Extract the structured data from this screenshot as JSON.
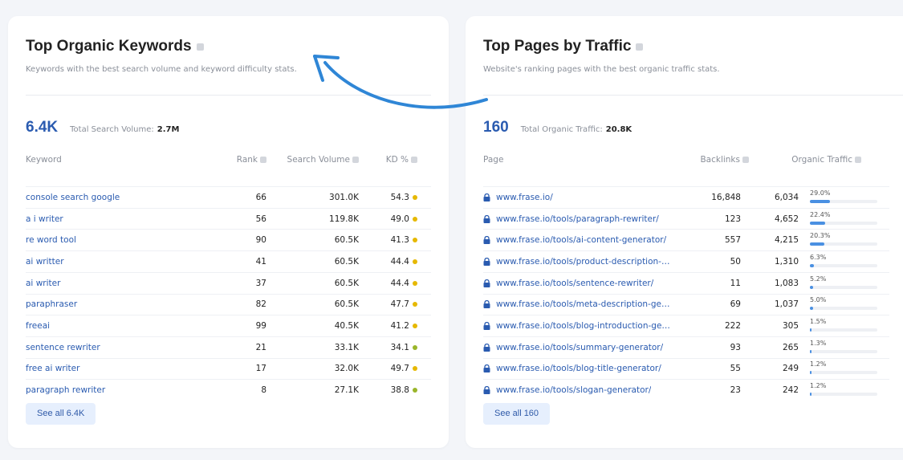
{
  "left": {
    "title": "Top Organic Keywords",
    "subtitle": "Keywords with the best search volume and keyword difficulty stats.",
    "big_number": "6.4K",
    "summary_label": "Total Search Volume:",
    "summary_value": "2.7M",
    "columns": {
      "keyword": "Keyword",
      "rank": "Rank",
      "volume": "Search Volume",
      "kd": "KD %"
    },
    "rows": [
      {
        "keyword": "console search google",
        "rank": "66",
        "volume": "301.0K",
        "kd": "54.3",
        "kd_color": "#e6b800"
      },
      {
        "keyword": "a i writer",
        "rank": "56",
        "volume": "119.8K",
        "kd": "49.0",
        "kd_color": "#e6b800"
      },
      {
        "keyword": "re word tool",
        "rank": "90",
        "volume": "60.5K",
        "kd": "41.3",
        "kd_color": "#e6b800"
      },
      {
        "keyword": "ai writter",
        "rank": "41",
        "volume": "60.5K",
        "kd": "44.4",
        "kd_color": "#e6b800"
      },
      {
        "keyword": "ai writer",
        "rank": "37",
        "volume": "60.5K",
        "kd": "44.4",
        "kd_color": "#e6b800"
      },
      {
        "keyword": "paraphraser",
        "rank": "82",
        "volume": "60.5K",
        "kd": "47.7",
        "kd_color": "#e6b800"
      },
      {
        "keyword": "freeai",
        "rank": "99",
        "volume": "40.5K",
        "kd": "41.2",
        "kd_color": "#e6b800"
      },
      {
        "keyword": "sentence rewriter",
        "rank": "21",
        "volume": "33.1K",
        "kd": "34.1",
        "kd_color": "#9ab52a"
      },
      {
        "keyword": "free ai writer",
        "rank": "17",
        "volume": "32.0K",
        "kd": "49.7",
        "kd_color": "#e6b800"
      },
      {
        "keyword": "paragraph rewriter",
        "rank": "8",
        "volume": "27.1K",
        "kd": "38.8",
        "kd_color": "#9ab52a"
      }
    ],
    "see_all": "See all 6.4K"
  },
  "right": {
    "title": "Top Pages by Traffic",
    "subtitle": "Website's ranking pages with the best organic traffic stats.",
    "big_number": "160",
    "summary_label": "Total Organic Traffic:",
    "summary_value": "20.8K",
    "columns": {
      "page": "Page",
      "backlinks": "Backlinks",
      "traffic": "Organic Traffic"
    },
    "rows": [
      {
        "page": "www.frase.io/",
        "backlinks": "16,848",
        "traffic": "6,034",
        "pct": "29.0%",
        "share": 0.29
      },
      {
        "page": "www.frase.io/tools/paragraph-rewriter/",
        "backlinks": "123",
        "traffic": "4,652",
        "pct": "22.4%",
        "share": 0.224
      },
      {
        "page": "www.frase.io/tools/ai-content-generator/",
        "backlinks": "557",
        "traffic": "4,215",
        "pct": "20.3%",
        "share": 0.203
      },
      {
        "page": "www.frase.io/tools/product-description-…",
        "backlinks": "50",
        "traffic": "1,310",
        "pct": "6.3%",
        "share": 0.063
      },
      {
        "page": "www.frase.io/tools/sentence-rewriter/",
        "backlinks": "11",
        "traffic": "1,083",
        "pct": "5.2%",
        "share": 0.052
      },
      {
        "page": "www.frase.io/tools/meta-description-ge…",
        "backlinks": "69",
        "traffic": "1,037",
        "pct": "5.0%",
        "share": 0.05
      },
      {
        "page": "www.frase.io/tools/blog-introduction-ge…",
        "backlinks": "222",
        "traffic": "305",
        "pct": "1.5%",
        "share": 0.015
      },
      {
        "page": "www.frase.io/tools/summary-generator/",
        "backlinks": "93",
        "traffic": "265",
        "pct": "1.3%",
        "share": 0.013
      },
      {
        "page": "www.frase.io/tools/blog-title-generator/",
        "backlinks": "55",
        "traffic": "249",
        "pct": "1.2%",
        "share": 0.012
      },
      {
        "page": "www.frase.io/tools/slogan-generator/",
        "backlinks": "23",
        "traffic": "242",
        "pct": "1.2%",
        "share": 0.012
      }
    ],
    "see_all": "See all 160"
  },
  "colors": {
    "link": "#2a5bb0",
    "bar": "#4a90e2",
    "button_bg": "#e6effd",
    "arrow": "#2f86d6"
  },
  "icons": {
    "info": "info-icon",
    "lock": "lock-icon",
    "arrow": "curved-arrow-icon"
  }
}
